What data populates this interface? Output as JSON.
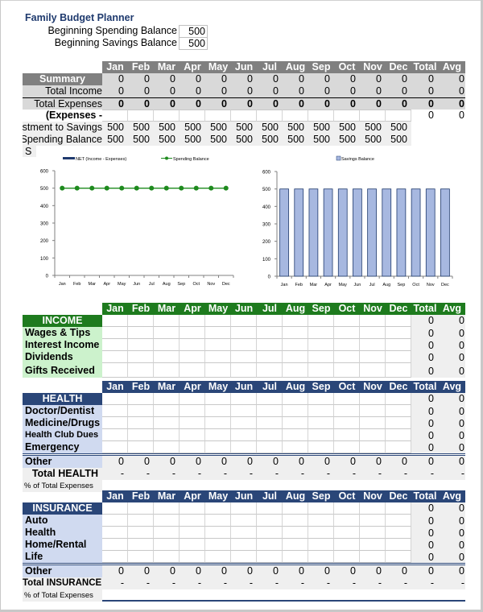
{
  "title": "Family Budget Planner",
  "balances": {
    "spending_label": "Beginning Spending Balance",
    "spending_value": "500",
    "savings_label": "Beginning Savings Balance",
    "savings_value": "500"
  },
  "months": [
    "Jan",
    "Feb",
    "Mar",
    "Apr",
    "May",
    "Jun",
    "Jul",
    "Aug",
    "Sep",
    "Oct",
    "Nov",
    "Dec"
  ],
  "total_label": "Total",
  "avg_label": "Avg",
  "summary": {
    "title": "Summary",
    "rows": [
      {
        "label": "Total Income",
        "values": [
          "0",
          "0",
          "0",
          "0",
          "0",
          "0",
          "0",
          "0",
          "0",
          "0",
          "0",
          "0"
        ],
        "total": "0",
        "avg": "0"
      },
      {
        "label": "Total Expenses",
        "values": [
          "0",
          "0",
          "0",
          "0",
          "0",
          "0",
          "0",
          "0",
          "0",
          "0",
          "0",
          "0"
        ],
        "total": "0",
        "avg": "0"
      },
      {
        "label": "- Expenses)",
        "values": [
          "",
          "",
          "",
          "",
          "",
          "",
          "",
          "",
          "",
          "",
          "",
          ""
        ],
        "total": "0",
        "avg": "0"
      },
      {
        "label": "stment to Savings",
        "values": [
          "500",
          "500",
          "500",
          "500",
          "500",
          "500",
          "500",
          "500",
          "500",
          "500",
          "500",
          "500"
        ],
        "total": "",
        "avg": ""
      },
      {
        "label": "Spending Balance",
        "values": [
          "500",
          "500",
          "500",
          "500",
          "500",
          "500",
          "500",
          "500",
          "500",
          "500",
          "500",
          "500"
        ],
        "total": "",
        "avg": ""
      }
    ],
    "trailing_label": "S"
  },
  "chart_data": [
    {
      "type": "line",
      "title": "",
      "legend": [
        "NET (Income - Expenses)",
        "Spending Balance"
      ],
      "legend_position": "top",
      "categories": [
        "Jan",
        "Feb",
        "Mar",
        "Apr",
        "May",
        "Jun",
        "Jul",
        "Aug",
        "Sep",
        "Oct",
        "Nov",
        "Dec"
      ],
      "series": [
        {
          "name": "NET (Income - Expenses)",
          "type": "bar",
          "color": "#1f3a6e",
          "values": [
            0,
            0,
            0,
            0,
            0,
            0,
            0,
            0,
            0,
            0,
            0,
            0
          ]
        },
        {
          "name": "Spending Balance",
          "type": "line",
          "color": "#1e8a1e",
          "values": [
            500,
            500,
            500,
            500,
            500,
            500,
            500,
            500,
            500,
            500,
            500,
            500
          ]
        }
      ],
      "yticks": [
        0,
        100,
        200,
        300,
        400,
        500,
        600
      ],
      "ylim": [
        0,
        600
      ],
      "xlabel": "",
      "ylabel": ""
    },
    {
      "type": "bar",
      "title": "",
      "legend": [
        "Savings Balance"
      ],
      "legend_position": "top",
      "categories": [
        "Jan",
        "Feb",
        "Mar",
        "Apr",
        "May",
        "Jun",
        "Jul",
        "Aug",
        "Sep",
        "Oct",
        "Nov",
        "Dec"
      ],
      "series": [
        {
          "name": "Savings Balance",
          "color": "#a7b8e0",
          "values": [
            500,
            500,
            500,
            500,
            500,
            500,
            500,
            500,
            500,
            500,
            500,
            500
          ]
        }
      ],
      "yticks": [
        0,
        100,
        200,
        300,
        400,
        500,
        600
      ],
      "ylim": [
        0,
        600
      ],
      "xlabel": "",
      "ylabel": ""
    }
  ],
  "income": {
    "title": "INCOME",
    "rows": [
      {
        "label": "Wages & Tips",
        "total": "0",
        "avg": "0"
      },
      {
        "label": "Interest Income",
        "total": "0",
        "avg": "0"
      },
      {
        "label": "Dividends",
        "total": "0",
        "avg": "0"
      },
      {
        "label": "Gifts Received",
        "total": "0",
        "avg": "0"
      }
    ]
  },
  "health": {
    "title": "HEALTH",
    "rows": [
      {
        "label": "Doctor/Dentist",
        "total": "0",
        "avg": "0"
      },
      {
        "label": "Medicine/Drugs",
        "total": "0",
        "avg": "0"
      },
      {
        "label": "Health Club Dues",
        "total": "0",
        "avg": "0"
      },
      {
        "label": "Emergency",
        "total": "0",
        "avg": "0"
      }
    ],
    "other": {
      "label": "Other",
      "values": [
        "0",
        "0",
        "0",
        "0",
        "0",
        "0",
        "0",
        "0",
        "0",
        "0",
        "0",
        "0"
      ],
      "total": "0",
      "avg": "0"
    },
    "total_row": {
      "label": "Total HEALTH",
      "values": [
        "-",
        "-",
        "-",
        "-",
        "-",
        "-",
        "-",
        "-",
        "-",
        "-",
        "-",
        "-"
      ],
      "total": "-",
      "avg": "-"
    },
    "pct_label": "% of Total Expenses"
  },
  "insurance": {
    "title": "INSURANCE",
    "rows": [
      {
        "label": "Auto",
        "total": "0",
        "avg": "0"
      },
      {
        "label": "Health",
        "total": "0",
        "avg": "0"
      },
      {
        "label": "Home/Rental",
        "total": "0",
        "avg": "0"
      },
      {
        "label": "Life",
        "total": "0",
        "avg": "0"
      }
    ],
    "other": {
      "label": "Other",
      "values": [
        "0",
        "0",
        "0",
        "0",
        "0",
        "0",
        "0",
        "0",
        "0",
        "0",
        "0",
        "0"
      ],
      "total": "0",
      "avg": "0"
    },
    "total_row": {
      "label": "Total INSURANCE",
      "values": [
        "-",
        "-",
        "-",
        "-",
        "-",
        "-",
        "-",
        "-",
        "-",
        "-",
        "-",
        "-"
      ],
      "total": "-",
      "avg": "-"
    },
    "pct_label": "% of Total Expenses"
  }
}
